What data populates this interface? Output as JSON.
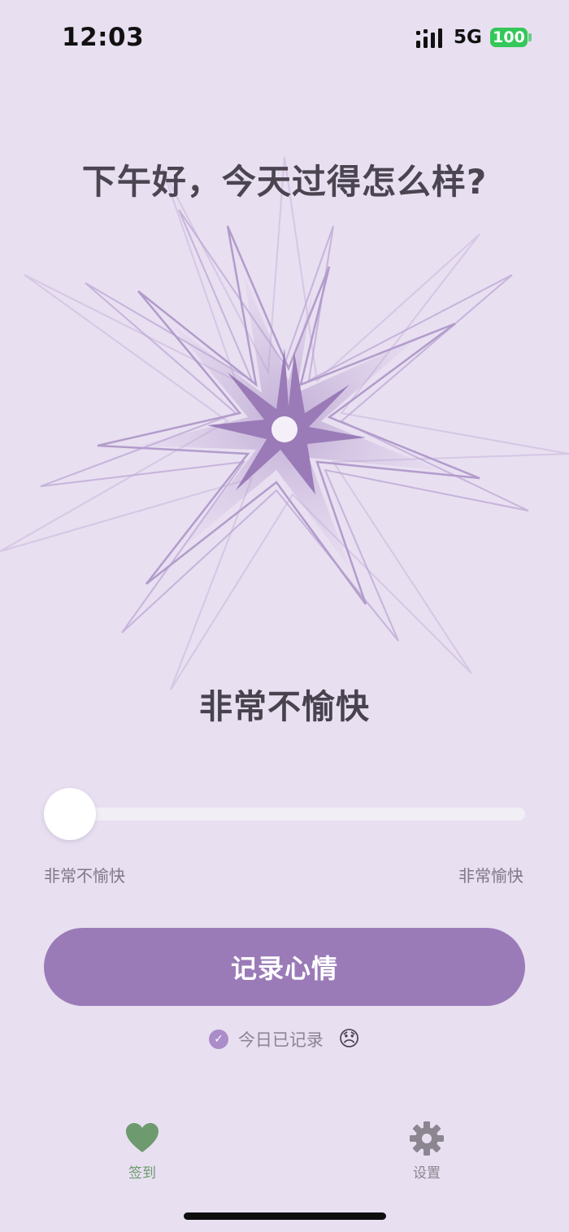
{
  "status_bar": {
    "time": "12:03",
    "network": "5G",
    "battery": "100"
  },
  "greeting": "下午好，今天过得怎么样?",
  "mood": {
    "current_label": "非常不愉快",
    "level": 0.0
  },
  "slider": {
    "min_label": "非常不愉快",
    "max_label": "非常愉快"
  },
  "record_button": {
    "label": "记录心情"
  },
  "recorded_status": {
    "text": "今日已记录",
    "emoji": "😞"
  },
  "tab_bar": {
    "items": [
      {
        "label": "签到",
        "icon": "heart-icon",
        "active": true
      },
      {
        "label": "设置",
        "icon": "gear-icon",
        "active": false
      }
    ]
  },
  "colors": {
    "background": "#E8DFF1",
    "accent": "#9A7BB8",
    "active_tab": "#6E9A6F",
    "inactive_tab": "#8B8690"
  }
}
